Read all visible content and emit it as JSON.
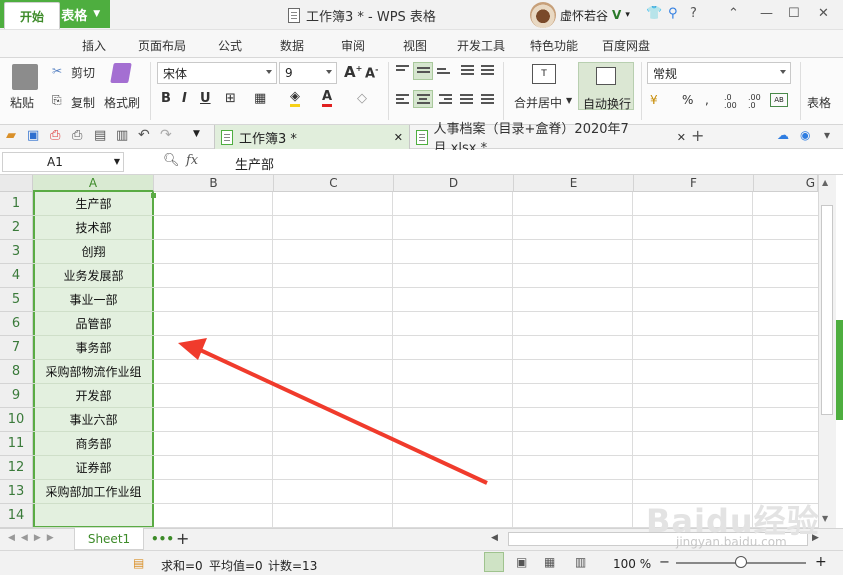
{
  "app": {
    "name": "WPS 表格",
    "window_title": "工作簿3 * - WPS 表格",
    "user": "虚怀若谷"
  },
  "menu_tabs": [
    "开始",
    "插入",
    "页面布局",
    "公式",
    "数据",
    "审阅",
    "视图",
    "开发工具",
    "特色功能",
    "百度网盘"
  ],
  "ribbon": {
    "paste": "粘贴",
    "cut": "剪切",
    "copy": "复制",
    "format_painter": "格式刷",
    "font_name": "宋体",
    "font_size": "9",
    "merge_center": "合并居中",
    "wrap_text": "自动换行",
    "number_format": "常规",
    "percent": "%",
    "table_style": "表格"
  },
  "doc_tabs": [
    {
      "label": "工作簿3 *",
      "active": true
    },
    {
      "label": "人事档案（目录+盒脊）2020年7月.xlsx *",
      "active": false
    }
  ],
  "formula_bar": {
    "name_box": "A1",
    "fx": "fx",
    "content": "生产部"
  },
  "columns": [
    "A",
    "B",
    "C",
    "D",
    "E",
    "F",
    "G"
  ],
  "rows": [
    "1",
    "2",
    "3",
    "4",
    "5",
    "6",
    "7",
    "8",
    "9",
    "10",
    "11",
    "12",
    "13",
    "14"
  ],
  "column_a": [
    "生产部",
    "技术部",
    "创翔",
    "业务发展部",
    "事业一部",
    "品管部",
    "事务部",
    "采购部物流作业组",
    "开发部",
    "事业六部",
    "商务部",
    "证券部",
    "采购部加工作业组",
    ""
  ],
  "sheet_tabs": [
    "Sheet1"
  ],
  "status": {
    "sum": "求和=0",
    "average": "平均值=0",
    "count": "计数=13",
    "zoom": "100 %"
  },
  "watermark": {
    "brand": "Baidu经验",
    "url": "jingyan.baidu.com"
  },
  "colors": {
    "accent": "#4eae3f",
    "selection": "#e3f0df",
    "arrow": "#f03b2c"
  }
}
